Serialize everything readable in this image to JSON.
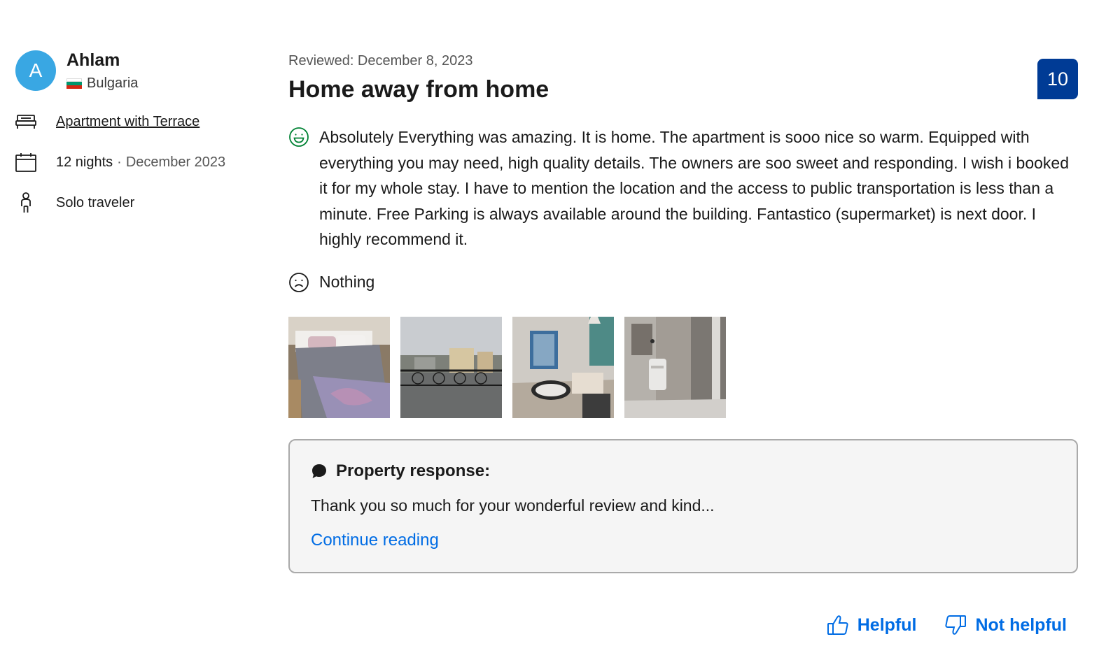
{
  "reviewer": {
    "initial": "A",
    "name": "Ahlam",
    "country": "Bulgaria",
    "avatar_color": "#39a7e3"
  },
  "stay": {
    "room": "Apartment with Terrace",
    "nights": "12 nights",
    "separator": "·",
    "month": "December 2023",
    "traveler_type": "Solo traveler"
  },
  "review": {
    "reviewed_date": "Reviewed: December 8, 2023",
    "title": "Home away from home",
    "score": "10",
    "score_color": "#003b95",
    "positive": "Absolutely Everything was amazing. It is home. The apartment is sooo nice so warm. Equipped with everything you may need, high quality details. The owners are soo sweet and responding. I wish i booked it for my whole stay. I have to mention the location and the access to public transportation is less than a minute. Free Parking is always available around the building. Fantastico (supermarket) is next door. I highly recommend it.",
    "negative": "Nothing",
    "photos": [
      "bedroom-photo",
      "balcony-view-photo",
      "living-room-photo",
      "bathroom-photo"
    ]
  },
  "property_response": {
    "heading": "Property response:",
    "text": "Thank you so much for your wonderful review and kind...",
    "continue_label": "Continue reading"
  },
  "actions": {
    "helpful_label": "Helpful",
    "not_helpful_label": "Not helpful",
    "link_color": "#006ce4"
  }
}
